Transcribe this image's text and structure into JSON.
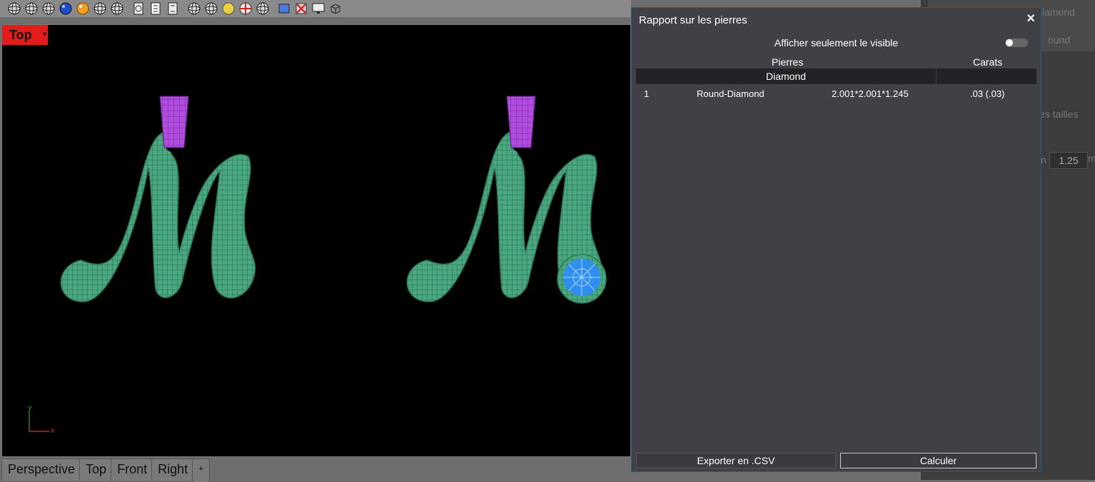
{
  "toolbar": {
    "icons": [
      "wireframe-sphere-icon",
      "shaded-sphere-icon",
      "rendered-sphere-icon",
      "blue-material-sphere-icon",
      "gold-material-sphere-icon",
      "ghosted-sphere-icon",
      "xray-sphere-icon",
      "shaded-object-icon",
      "technical-object-icon",
      "artistic-object-icon",
      "wireframe-globe-icon",
      "white-sphere-icon",
      "yellow-sphere-icon",
      "target-sphere-icon",
      "environment-sphere-icon",
      "capture-viewport-icon",
      "remove-object-icon",
      "monitor-icon",
      "box-outline-icon"
    ]
  },
  "viewport": {
    "label": "Top",
    "axis_x": "x",
    "axis_y": "y"
  },
  "viewport_tabs": [
    "Perspective",
    "Top",
    "Front",
    "Right",
    "+"
  ],
  "dialog": {
    "title": "Rapport sur les pierres",
    "close": "×",
    "show_visible_label": "Afficher seulement le visible",
    "show_visible_on": false,
    "columns": {
      "stones": "Pierres",
      "carats": "Carats"
    },
    "group": "Diamond",
    "rows": [
      {
        "index": "1",
        "name": "Round-Diamond",
        "size": "2.001*2.001*1.245",
        "carats": ".03 (.03)"
      }
    ],
    "export_button": "Exporter en .CSV",
    "calc_button": "Calculer"
  },
  "right_panel": {
    "item1": "iamond",
    "item2": "ound",
    "item3": "es tailles",
    "unit_prefix": "n",
    "value": "1.25",
    "unit_suffix": "m"
  },
  "colors": {
    "viewport_label_bg": "#e31b1b",
    "mesh_green": "#49a57e",
    "bail_purple": "#b24be0",
    "stone_blue": "#2f8ef0",
    "dialog_bg": "#404047"
  }
}
